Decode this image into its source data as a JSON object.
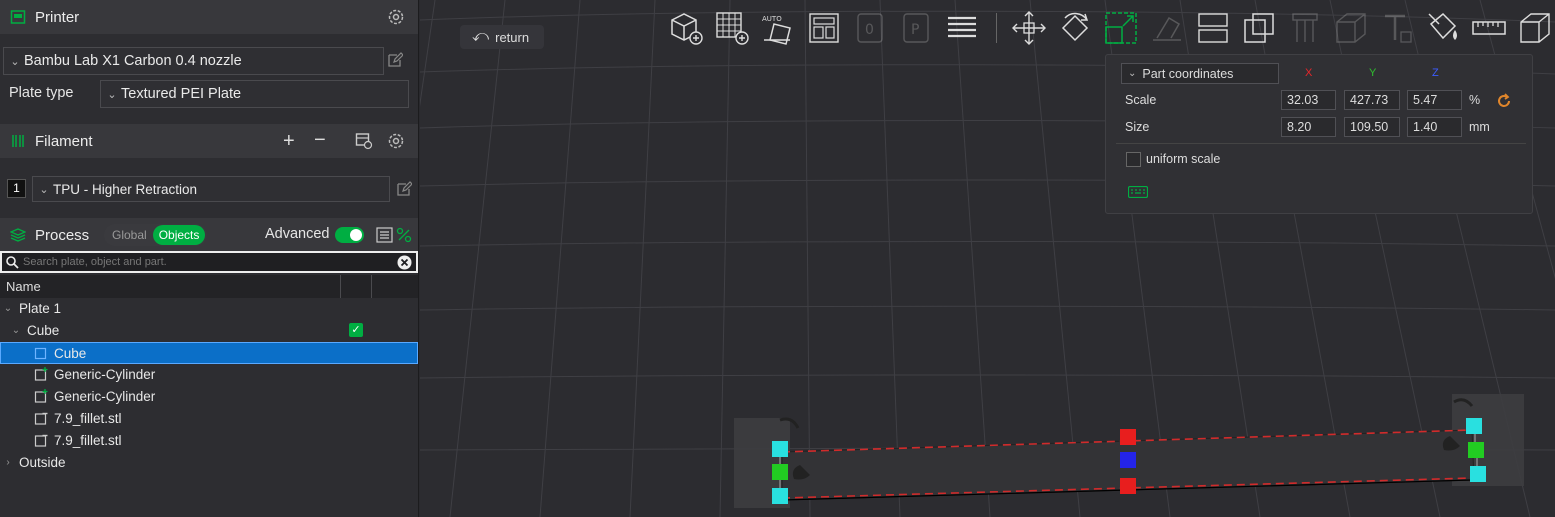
{
  "printer": {
    "title": "Printer",
    "printer_name": "Bambu Lab X1 Carbon 0.4 nozzle",
    "plate_type_label": "Plate type",
    "plate_type_value": "Textured PEI Plate"
  },
  "filament": {
    "title": "Filament",
    "items": [
      {
        "index": "1",
        "name": "TPU - Higher Retraction"
      }
    ]
  },
  "process": {
    "title": "Process",
    "global_label": "Global",
    "objects_label": "Objects",
    "advanced_label": "Advanced",
    "advanced_on": true
  },
  "object_list": {
    "search_placeholder": "Search plate, object and part.",
    "column_name": "Name",
    "rows": [
      {
        "label": "Plate 1"
      },
      {
        "label": "Cube"
      },
      {
        "label": "Cube",
        "selected": true
      },
      {
        "label": "Generic-Cylinder"
      },
      {
        "label": "Generic-Cylinder"
      },
      {
        "label": "7.9_fillet.stl"
      },
      {
        "label": "7.9_fillet.stl"
      },
      {
        "label": "Outside"
      }
    ]
  },
  "viewport": {
    "return_label": "return",
    "toolbar_auto_label": "AUTO"
  },
  "scale_panel": {
    "coordinate_mode": "Part coordinates",
    "axes": [
      "X",
      "Y",
      "Z"
    ],
    "axis_colors": [
      "#e8262b",
      "#2fbf2f",
      "#3c5cff"
    ],
    "scale_label": "Scale",
    "scale_values": [
      "32.03",
      "427.73",
      "5.47"
    ],
    "scale_unit": "%",
    "size_label": "Size",
    "size_values": [
      "8.20",
      "109.50",
      "1.40"
    ],
    "size_unit": "mm",
    "uniform_scale_label": "uniform scale",
    "uniform_scale_checked": false
  },
  "colors": {
    "accent": "#00ae42",
    "selection": "#0b6fc8"
  }
}
